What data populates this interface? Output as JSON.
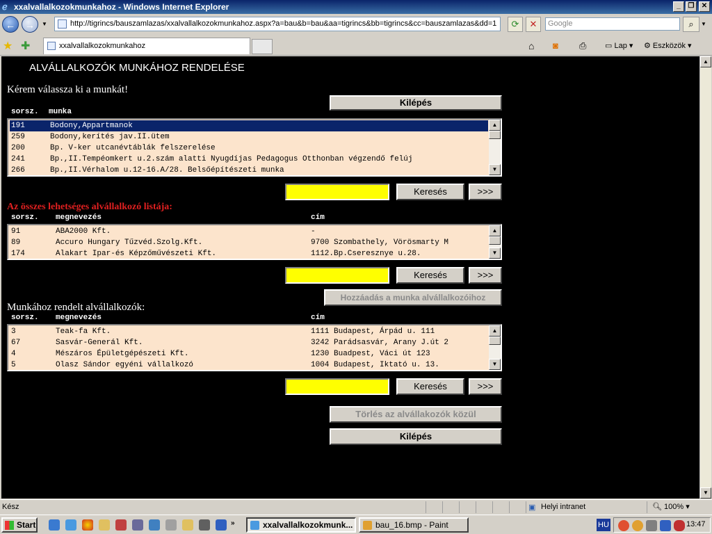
{
  "window": {
    "title": "xxalvallalkozokmunkahoz - Windows Internet Explorer"
  },
  "address": {
    "url": "http://tigrincs/bauszamlazas/xxalvallalkozokmunkahoz.aspx?a=bau&b=bau&aa=tigrincs&bb=tigrincs&cc=bauszamlazas&dd=1",
    "search_placeholder": "Google"
  },
  "tab": {
    "label": "xxalvallalkozokmunkahoz"
  },
  "toolbar": {
    "page_label": "Lap",
    "tools_label": "Eszközök"
  },
  "page": {
    "heading": "ALVÁLLALKOZÓK MUNKÁHOZ RENDELÉSE",
    "prompt": "Kérem válassza ki a munkát!",
    "exit_label": "Kilépés",
    "search_label": "Keresés",
    "next_label": ">>>",
    "add_label": "Hozzáadás a munka alvállalkozóihoz",
    "delete_label": "Törlés az alvállakozók közül",
    "work_section": {
      "col_nr": "sorsz.",
      "col_work": "munka",
      "rows": [
        {
          "nr": "191",
          "name": "Bodony,Appartmanok",
          "selected": true
        },
        {
          "nr": "259",
          "name": "Bodony,kerítés jav.II.ütem",
          "selected": false
        },
        {
          "nr": "200",
          "name": "Bp. V-ker utcanévtáblák felszerelése",
          "selected": false
        },
        {
          "nr": "241",
          "name": "Bp.,II.Tempéomkert u.2.szám alatti Nyugdíjas Pedagogus Otthonban végzendő felúj",
          "selected": false
        },
        {
          "nr": "266",
          "name": "Bp.,II.Vérhalom u.12-16.A/28. Belsőépítészeti munka",
          "selected": false
        }
      ]
    },
    "all_section": {
      "title": "Az összes lehetséges alvállalkozó listája:",
      "col_nr": "sorsz.",
      "col_name": "megnevezés",
      "col_addr": "cím",
      "rows": [
        {
          "nr": "91",
          "name": "ABA2000 Kft.",
          "addr": "-"
        },
        {
          "nr": "89",
          "name": "Accuro Hungary Tűzvéd.Szolg.Kft.",
          "addr": "9700 Szombathely, Vörösmarty M"
        },
        {
          "nr": "174",
          "name": "Alakart Ipar-és Képzőművészeti Kft.",
          "addr": "1112.Bp.Cseresznye u.28."
        }
      ]
    },
    "assigned_section": {
      "title": "Munkához rendelt alvállalkozók:",
      "col_nr": "sorsz.",
      "col_name": "megnevezés",
      "col_addr": "cím",
      "rows": [
        {
          "nr": "3",
          "name": "Teak-fa Kft.",
          "addr": "1111 Budapest, Árpád u. 111"
        },
        {
          "nr": "67",
          "name": "Sasvár-Generál Kft.",
          "addr": "3242 Parádsasvár, Arany J.út 2"
        },
        {
          "nr": "4",
          "name": "Mészáros Épületgépészeti Kft.",
          "addr": "1230 Buadpest, Váci út 123"
        },
        {
          "nr": "5",
          "name": "Olasz Sándor egyéni vállalkozó",
          "addr": "1004 Budapest, Iktató u. 13."
        }
      ]
    }
  },
  "status": {
    "text": "Kész",
    "zone": "Helyi intranet",
    "zoom": "100%"
  },
  "taskbar": {
    "start": "Start",
    "task1": "xxalvallalkozokmunk...",
    "task2": "bau_16.bmp - Paint",
    "lang": "HU",
    "clock": "13:47"
  }
}
